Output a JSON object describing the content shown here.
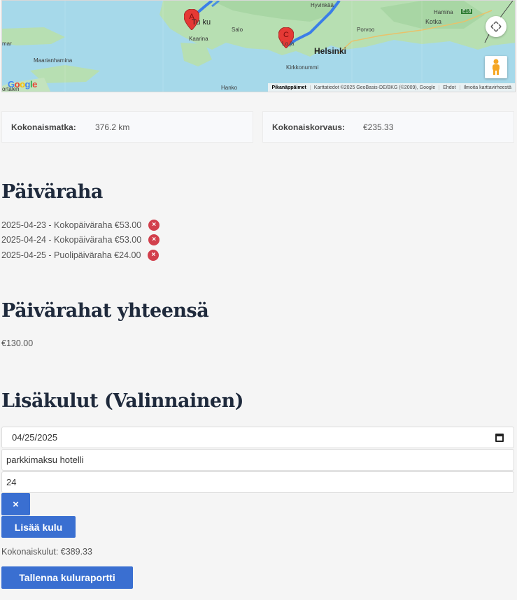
{
  "map": {
    "places": [
      "Hyvinkää",
      "Hamina",
      "Kotka",
      "Salo",
      "Porvoo",
      "Helsinki",
      "Kirkkonummi",
      "Maarianhamina",
      "Kaarina",
      "Turku",
      "Lohja",
      "Hanko",
      "mar",
      "E18",
      "ortalen"
    ],
    "pins": [
      "A",
      "C"
    ],
    "attribution": {
      "shortcuts": "Pikanäppäimet",
      "data": "Karttatiedot ©2025 GeoBasis-DE/BKG (©2009), Google",
      "terms": "Ehdot",
      "report": "Ilmoita karttavirheestä"
    },
    "logo": "Google"
  },
  "summary": {
    "distance_label": "Kokonaismatka:",
    "distance_value": "376.2 km",
    "reimb_label": "Kokonaiskorvaus:",
    "reimb_value": "€235.33"
  },
  "allowance": {
    "heading": "Päiväraha",
    "items": [
      {
        "text": "2025-04-23 - Kokopäiväraha €53.00"
      },
      {
        "text": "2025-04-24 - Kokopäiväraha €53.00"
      },
      {
        "text": "2025-04-25 - Puolipäiväraha €24.00"
      }
    ],
    "remove_glyph": "×"
  },
  "allowance_total": {
    "heading": "Päivärahat yhteensä",
    "value": "€130.00"
  },
  "extras": {
    "heading": "Lisäkulut (Valinnainen)",
    "date_value": "04/25/2025",
    "description_value": "parkkimaksu hotelli",
    "amount_value": "24",
    "remove_glyph": "×",
    "add_label": "Lisää kulu",
    "total_text": "Kokonaiskulut: €389.33",
    "save_label": "Tallenna kuluraportti"
  },
  "colors": {
    "primary": "#3a6fd1",
    "danger": "#d23f4c",
    "heading": "#1f2a3c"
  }
}
